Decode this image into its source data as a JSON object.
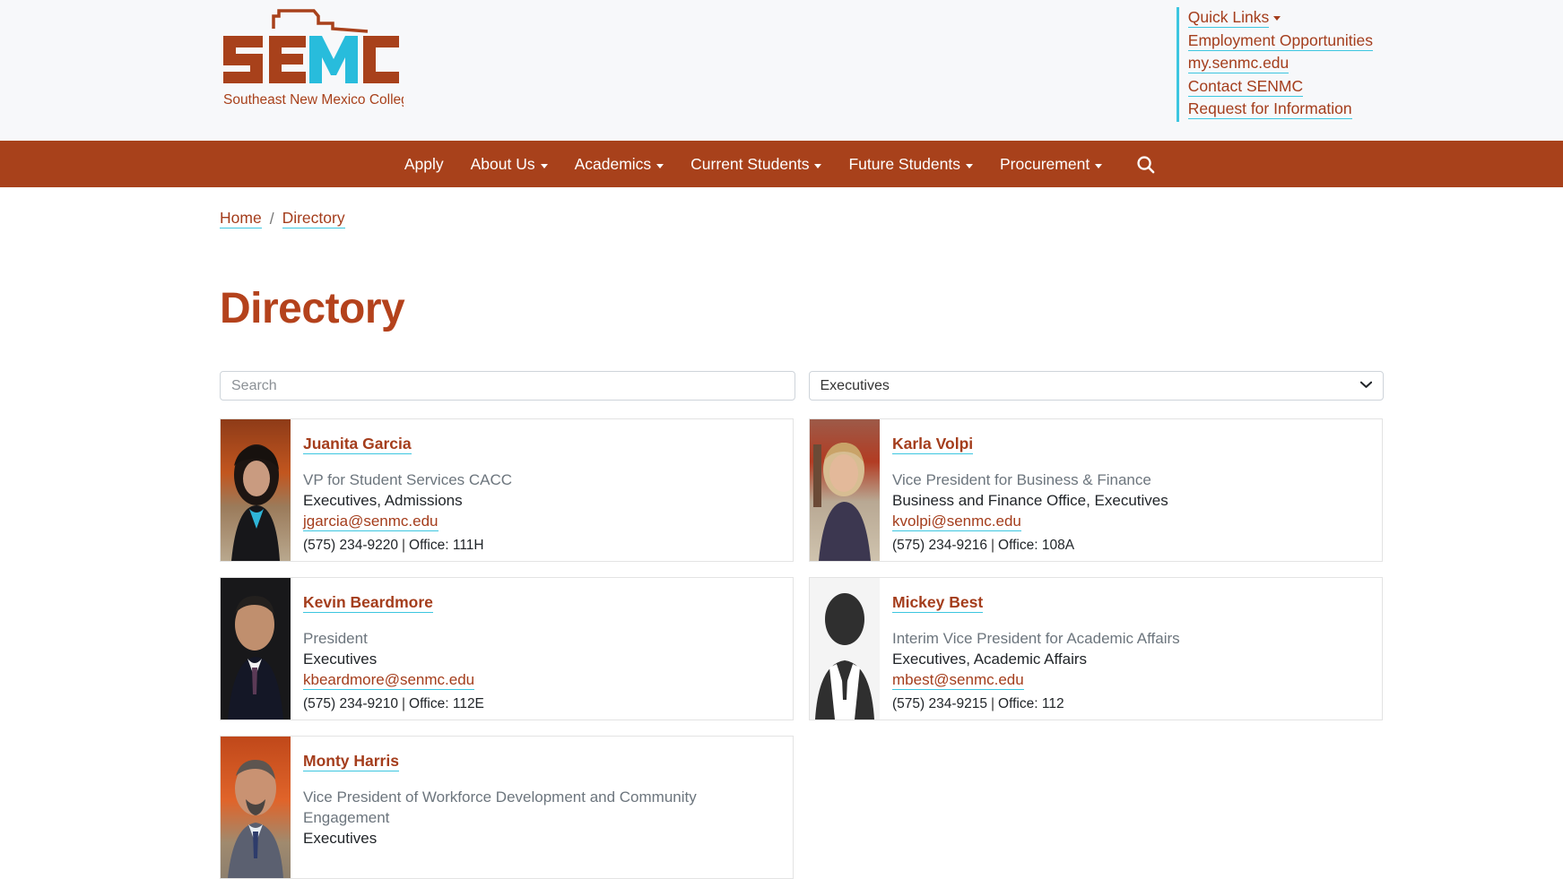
{
  "header": {
    "logo": {
      "mark_text": "SEMC",
      "tagline": "Southeast New Mexico College",
      "brand_rust": "#a8411b",
      "brand_cyan": "#28bcdc"
    },
    "quick_links": [
      {
        "label": "Quick Links",
        "has_caret": true
      },
      {
        "label": "Employment Opportunities",
        "has_caret": false
      },
      {
        "label": "my.senmc.edu",
        "has_caret": false
      },
      {
        "label": "Contact SENMC",
        "has_caret": false
      },
      {
        "label": "Request for Information",
        "has_caret": false
      }
    ]
  },
  "nav": {
    "items": [
      {
        "label": "Apply",
        "has_caret": false
      },
      {
        "label": "About Us",
        "has_caret": true
      },
      {
        "label": "Academics",
        "has_caret": true
      },
      {
        "label": "Current Students",
        "has_caret": true
      },
      {
        "label": "Future Students",
        "has_caret": true
      },
      {
        "label": "Procurement",
        "has_caret": true
      }
    ],
    "search_icon": "search-icon",
    "bar_color": "#a8411b"
  },
  "breadcrumb": {
    "home": "Home",
    "separator": "/",
    "current": "Directory"
  },
  "page": {
    "title": "Directory",
    "title_color": "#b4421c"
  },
  "filters": {
    "search_placeholder": "Search",
    "search_value": "",
    "category_selected": "Executives",
    "chevron_icon": "chevron-down-icon"
  },
  "directory": [
    {
      "name": "Juanita Garcia",
      "title": "VP for Student Services CACC",
      "department": "Executives, Admissions",
      "email": "jgarcia@senmc.edu",
      "phone": "(575) 234-9220",
      "office": "Office: 111H",
      "photo": "portrait-autumn-foliage"
    },
    {
      "name": "Karla Volpi",
      "title": "Vice President for Business & Finance",
      "department": "Business and Finance Office, Executives",
      "email": "kvolpi@senmc.edu",
      "phone": "(575) 234-9216",
      "office": "Office: 108A",
      "photo": "portrait-outdoor-red-tree"
    },
    {
      "name": "Kevin Beardmore",
      "title": "President",
      "department": "Executives",
      "email": "kbeardmore@senmc.edu",
      "phone": "(575) 234-9210",
      "office": "Office: 112E",
      "photo": "portrait-dark-studio"
    },
    {
      "name": "Mickey Best",
      "title": "Interim Vice President for Academic Affairs",
      "department": "Executives, Academic Affairs",
      "email": "mbest@senmc.edu",
      "phone": "(575) 234-9215",
      "office": "Office: 112",
      "photo": "silhouette-placeholder"
    },
    {
      "name": "Monty Harris",
      "title": "Vice President of Workforce Development and Community Engagement",
      "department": "Executives",
      "email": "",
      "phone": "",
      "office": "",
      "photo": "portrait-autumn-orange-tree"
    }
  ]
}
